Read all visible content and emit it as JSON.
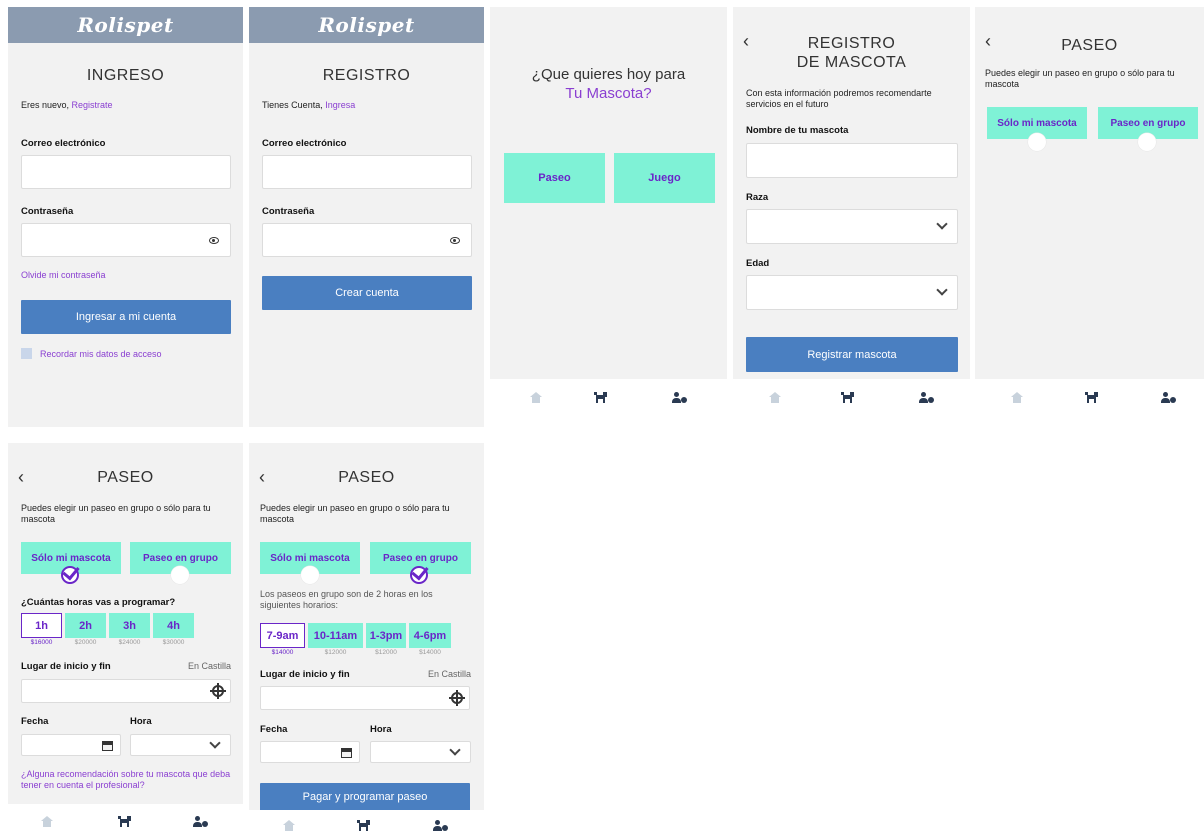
{
  "brand": "Rolispet",
  "login": {
    "title": "INGRESO",
    "new_text": "Eres nuevo,",
    "register_link": "Registrate",
    "email_label": "Correo electrónico",
    "password_label": "Contraseña",
    "forgot_link": "Olvide mi contraseña",
    "submit": "Ingresar a mi cuenta",
    "remember": "Recordar mis datos de acceso"
  },
  "register": {
    "title": "REGISTRO",
    "have_account": "Tienes Cuenta,",
    "login_link": "Ingresa",
    "email_label": "Correo electrónico",
    "password_label": "Contraseña",
    "submit": "Crear cuenta"
  },
  "home": {
    "question": "¿Que quieres hoy para",
    "question_highlight": "Tu Mascota?",
    "option_walk": "Paseo",
    "option_play": "Juego"
  },
  "pet_register": {
    "title_line1": "REGISTRO",
    "title_line2": "DE MASCOTA",
    "intro": "Con esta información podremos recomendarte servicios en el futuro",
    "name_label": "Nombre de tu mascota",
    "breed_label": "Raza",
    "age_label": "Edad",
    "submit": "Registrar mascota"
  },
  "walk": {
    "title": "PASEO",
    "intro": "Puedes elegir un paseo en grupo o sólo para tu mascota",
    "solo": "Sólo mi mascota",
    "group": "Paseo en grupo",
    "hours_question": "¿Cuántas horas vas a programar?",
    "hours": [
      {
        "label": "1h",
        "price": "$16000"
      },
      {
        "label": "2h",
        "price": "$20000"
      },
      {
        "label": "3h",
        "price": "$24000"
      },
      {
        "label": "4h",
        "price": "$30000"
      }
    ],
    "place_label": "Lugar de inicio y fin",
    "place_value": "En Castilla",
    "date_label": "Fecha",
    "time_label": "Hora",
    "recommend": "¿Alguna recomendación sobre tu mascota que deba tener en cuenta el profesional?",
    "group_schedule_note": "Los paseos en grupo son de 2 horas en los siguientes horarios:",
    "slots": [
      {
        "label": "7-9am",
        "price": "$14000"
      },
      {
        "label": "10-11am",
        "price": "$12000"
      },
      {
        "label": "1-3pm",
        "price": "$12000"
      },
      {
        "label": "4-6pm",
        "price": "$14000"
      }
    ],
    "pay": "Pagar y programar paseo"
  },
  "nav": {
    "home_icon": "home-icon",
    "dog_icon": "dog-icon",
    "user_icon": "user-settings-icon"
  },
  "colors": {
    "brand_bar": "#8b9bb0",
    "primary_button": "#4a7fc1",
    "mint": "#7ff2d6",
    "accent_purple": "#8a3fd1"
  }
}
